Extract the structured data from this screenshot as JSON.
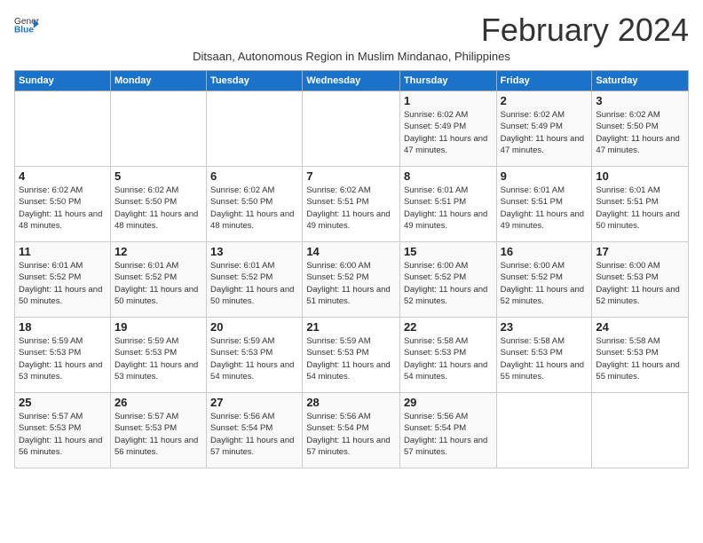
{
  "logo": {
    "general": "General",
    "blue": "Blue"
  },
  "title": "February 2024",
  "subtitle": "Ditsaan, Autonomous Region in Muslim Mindanao, Philippines",
  "days_header": [
    "Sunday",
    "Monday",
    "Tuesday",
    "Wednesday",
    "Thursday",
    "Friday",
    "Saturday"
  ],
  "weeks": [
    [
      {
        "day": "",
        "info": ""
      },
      {
        "day": "",
        "info": ""
      },
      {
        "day": "",
        "info": ""
      },
      {
        "day": "",
        "info": ""
      },
      {
        "day": "1",
        "info": "Sunrise: 6:02 AM\nSunset: 5:49 PM\nDaylight: 11 hours and 47 minutes."
      },
      {
        "day": "2",
        "info": "Sunrise: 6:02 AM\nSunset: 5:49 PM\nDaylight: 11 hours and 47 minutes."
      },
      {
        "day": "3",
        "info": "Sunrise: 6:02 AM\nSunset: 5:50 PM\nDaylight: 11 hours and 47 minutes."
      }
    ],
    [
      {
        "day": "4",
        "info": "Sunrise: 6:02 AM\nSunset: 5:50 PM\nDaylight: 11 hours and 48 minutes."
      },
      {
        "day": "5",
        "info": "Sunrise: 6:02 AM\nSunset: 5:50 PM\nDaylight: 11 hours and 48 minutes."
      },
      {
        "day": "6",
        "info": "Sunrise: 6:02 AM\nSunset: 5:50 PM\nDaylight: 11 hours and 48 minutes."
      },
      {
        "day": "7",
        "info": "Sunrise: 6:02 AM\nSunset: 5:51 PM\nDaylight: 11 hours and 49 minutes."
      },
      {
        "day": "8",
        "info": "Sunrise: 6:01 AM\nSunset: 5:51 PM\nDaylight: 11 hours and 49 minutes."
      },
      {
        "day": "9",
        "info": "Sunrise: 6:01 AM\nSunset: 5:51 PM\nDaylight: 11 hours and 49 minutes."
      },
      {
        "day": "10",
        "info": "Sunrise: 6:01 AM\nSunset: 5:51 PM\nDaylight: 11 hours and 50 minutes."
      }
    ],
    [
      {
        "day": "11",
        "info": "Sunrise: 6:01 AM\nSunset: 5:52 PM\nDaylight: 11 hours and 50 minutes."
      },
      {
        "day": "12",
        "info": "Sunrise: 6:01 AM\nSunset: 5:52 PM\nDaylight: 11 hours and 50 minutes."
      },
      {
        "day": "13",
        "info": "Sunrise: 6:01 AM\nSunset: 5:52 PM\nDaylight: 11 hours and 50 minutes."
      },
      {
        "day": "14",
        "info": "Sunrise: 6:00 AM\nSunset: 5:52 PM\nDaylight: 11 hours and 51 minutes."
      },
      {
        "day": "15",
        "info": "Sunrise: 6:00 AM\nSunset: 5:52 PM\nDaylight: 11 hours and 52 minutes."
      },
      {
        "day": "16",
        "info": "Sunrise: 6:00 AM\nSunset: 5:52 PM\nDaylight: 11 hours and 52 minutes."
      },
      {
        "day": "17",
        "info": "Sunrise: 6:00 AM\nSunset: 5:53 PM\nDaylight: 11 hours and 52 minutes."
      }
    ],
    [
      {
        "day": "18",
        "info": "Sunrise: 5:59 AM\nSunset: 5:53 PM\nDaylight: 11 hours and 53 minutes."
      },
      {
        "day": "19",
        "info": "Sunrise: 5:59 AM\nSunset: 5:53 PM\nDaylight: 11 hours and 53 minutes."
      },
      {
        "day": "20",
        "info": "Sunrise: 5:59 AM\nSunset: 5:53 PM\nDaylight: 11 hours and 54 minutes."
      },
      {
        "day": "21",
        "info": "Sunrise: 5:59 AM\nSunset: 5:53 PM\nDaylight: 11 hours and 54 minutes."
      },
      {
        "day": "22",
        "info": "Sunrise: 5:58 AM\nSunset: 5:53 PM\nDaylight: 11 hours and 54 minutes."
      },
      {
        "day": "23",
        "info": "Sunrise: 5:58 AM\nSunset: 5:53 PM\nDaylight: 11 hours and 55 minutes."
      },
      {
        "day": "24",
        "info": "Sunrise: 5:58 AM\nSunset: 5:53 PM\nDaylight: 11 hours and 55 minutes."
      }
    ],
    [
      {
        "day": "25",
        "info": "Sunrise: 5:57 AM\nSunset: 5:53 PM\nDaylight: 11 hours and 56 minutes."
      },
      {
        "day": "26",
        "info": "Sunrise: 5:57 AM\nSunset: 5:53 PM\nDaylight: 11 hours and 56 minutes."
      },
      {
        "day": "27",
        "info": "Sunrise: 5:56 AM\nSunset: 5:54 PM\nDaylight: 11 hours and 57 minutes."
      },
      {
        "day": "28",
        "info": "Sunrise: 5:56 AM\nSunset: 5:54 PM\nDaylight: 11 hours and 57 minutes."
      },
      {
        "day": "29",
        "info": "Sunrise: 5:56 AM\nSunset: 5:54 PM\nDaylight: 11 hours and 57 minutes."
      },
      {
        "day": "",
        "info": ""
      },
      {
        "day": "",
        "info": ""
      }
    ]
  ]
}
